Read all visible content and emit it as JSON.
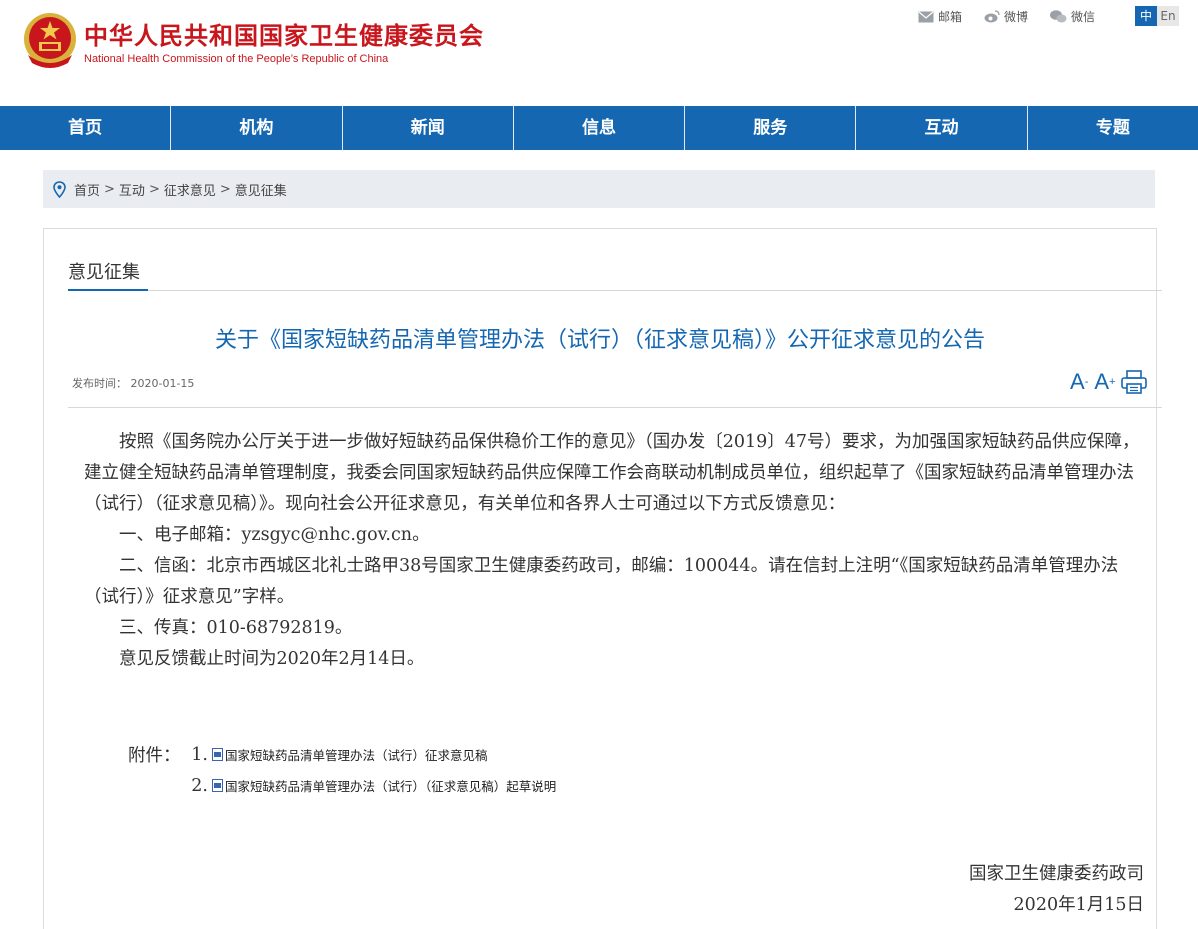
{
  "header": {
    "title_cn": "中华人民共和国国家卫生健康委员会",
    "title_en": "National Health Commission of the People’s Republic of China",
    "links": [
      {
        "label": "邮箱",
        "icon": "mail-icon"
      },
      {
        "label": "微博",
        "icon": "weibo-icon"
      },
      {
        "label": "微信",
        "icon": "wechat-icon"
      }
    ],
    "lang": {
      "cn": "中",
      "en": "En"
    }
  },
  "nav": [
    "首页",
    "机构",
    "新闻",
    "信息",
    "服务",
    "互动",
    "专题"
  ],
  "breadcrumb": [
    "首页",
    "互动",
    "征求意见",
    "意见征集"
  ],
  "breadcrumb_sep": ">",
  "section_title": "意见征集",
  "article": {
    "title": "关于《国家短缺药品清单管理办法（试行）（征求意见稿）》公开征求意见的公告",
    "pubdate": "发布时间： 2020-01-15",
    "font_small": "A",
    "font_small_sup": "-",
    "font_large": "A",
    "font_large_sup": "+",
    "paragraphs": [
      "按照《国务院办公厅关于进一步做好短缺药品保供稳价工作的意见》（国办发〔2019〕47号）要求，为加强国家短缺药品供应保障，建立健全短缺药品清单管理制度，我委会同国家短缺药品供应保障工作会商联动机制成员单位，组织起草了《国家短缺药品清单管理办法（试行）（征求意见稿）》。现向社会公开征求意见，有关单位和各界人士可通过以下方式反馈意见：",
      "一、电子邮箱：yzsgyc@nhc.gov.cn。",
      "二、信函：北京市西城区北礼士路甲38号国家卫生健康委药政司，邮编：100044。请在信封上注明“《国家短缺药品清单管理办法（试行）》征求意见”字样。",
      "三、传真：010-68792819。",
      "意见反馈截止时间为2020年2月14日。"
    ],
    "attachments_label": "附件：",
    "attachments": [
      {
        "num": "1.",
        "label": "国家短缺药品清单管理办法（试行）征求意见稿"
      },
      {
        "num": "2.",
        "label": "国家短缺药品清单管理办法（试行）（征求意见稿）起草说明"
      }
    ],
    "signature": "国家卫生健康委药政司",
    "sign_date": "2020年1月15日"
  },
  "colors": {
    "brand_red": "#c8161d",
    "brand_blue": "#1667b2"
  }
}
